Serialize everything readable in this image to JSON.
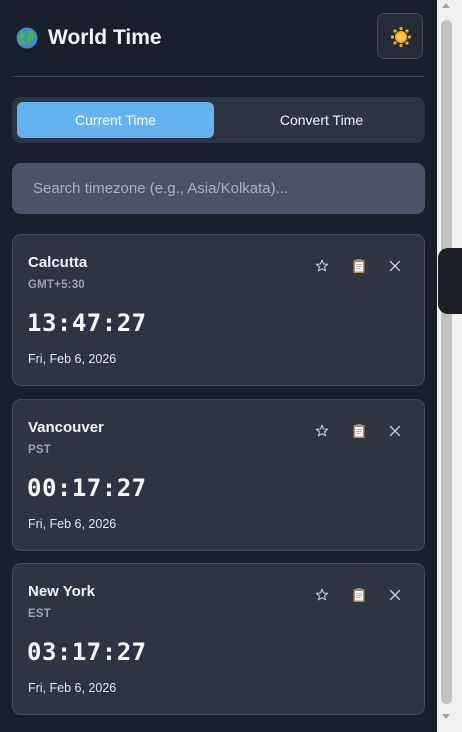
{
  "app": {
    "title": "World Time",
    "globe_icon": "globe-icon",
    "theme_icon": "sun-icon"
  },
  "tabs": [
    {
      "label": "Current Time",
      "active": true
    },
    {
      "label": "Convert Time",
      "active": false
    }
  ],
  "search": {
    "placeholder": "Search timezone (e.g., Asia/Kolkata)..."
  },
  "cards": [
    {
      "city": "Calcutta",
      "tz": "GMT+5:30",
      "time": "13:47:27",
      "date": "Fri, Feb 6, 2026"
    },
    {
      "city": "Vancouver",
      "tz": "PST",
      "time": "00:17:27",
      "date": "Fri, Feb 6, 2026"
    },
    {
      "city": "New York",
      "tz": "EST",
      "time": "03:17:27",
      "date": "Fri, Feb 6, 2026"
    }
  ],
  "card_actions": [
    "star-icon",
    "clipboard-icon",
    "close-icon"
  ],
  "colors": {
    "background": "#1a202b",
    "card": "#2d3444",
    "accent": "#64b3f0",
    "search": "#4a5466"
  }
}
